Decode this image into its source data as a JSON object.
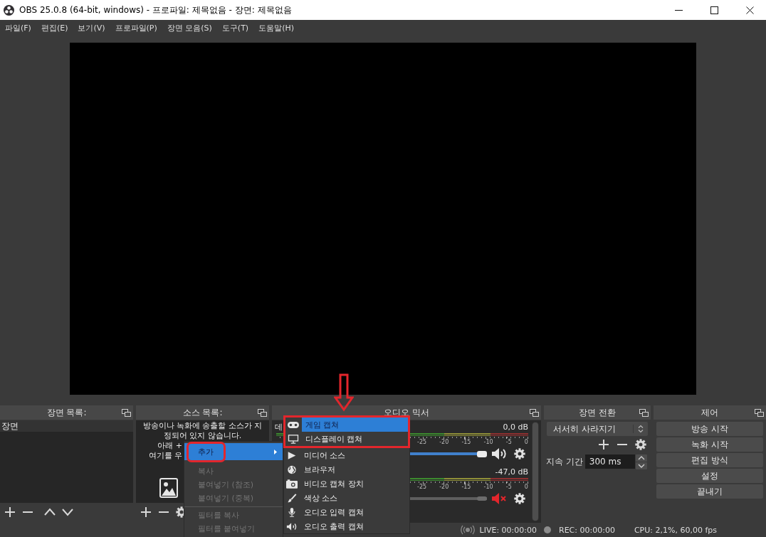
{
  "window": {
    "title": "OBS 25.0.8 (64-bit, windows) - 프로파일: 제목없음 - 장면: 제목없음"
  },
  "menu_bar": [
    "파일(F)",
    "편집(E)",
    "보기(V)",
    "프로파일(P)",
    "장면 모음(S)",
    "도구(T)",
    "도움말(H)"
  ],
  "scene_list": {
    "title": "장면 목록:",
    "items": [
      {
        "label": "장면",
        "selected": true
      }
    ]
  },
  "source_list": {
    "title": "소스 목록:",
    "hint": [
      "방송이나 녹화에 송출할 소스가 지",
      "정되어 있지 않습니다."
    ],
    "hint_cut": [
      "아래 +",
      "여기를 우"
    ]
  },
  "audio_mixer": {
    "title": "오디오 믹서",
    "channels": [
      {
        "name": "데",
        "reading": "0,0 dB",
        "scale": [
          "-25",
          "-20",
          "-15",
          "-10",
          "-5",
          "0"
        ],
        "muted": false,
        "level": 1
      },
      {
        "reading": "-47,0 dB",
        "scale": [
          "-25",
          "-20",
          "-15",
          "-10",
          "-5",
          "0"
        ],
        "muted": true,
        "level": 1
      }
    ]
  },
  "scene_transitions": {
    "title": "장면 전환",
    "transition": "서서히 사라지기",
    "duration_label": "지속 기간",
    "duration": "300 ms"
  },
  "controls": {
    "title": "제어",
    "buttons": [
      "방송 시작",
      "녹화 시작",
      "편집 방식",
      "설정",
      "끝내기"
    ]
  },
  "status_bar": {
    "live": "LIVE: 00:00:00",
    "rec": "REC: 00:00:00",
    "cpu": "CPU: 2,1%, 60,00 fps"
  },
  "context_menu": {
    "items": [
      {
        "kind": "item",
        "label": "추가",
        "selected": true,
        "disabled": false,
        "submenu": true,
        "annotated": true
      },
      {
        "kind": "item",
        "label": "복사",
        "selected": false,
        "disabled": true,
        "submenu": false,
        "annotated": false
      },
      {
        "kind": "item",
        "label": "붙여넣기 (참조)",
        "selected": false,
        "disabled": true,
        "submenu": false,
        "annotated": false
      },
      {
        "kind": "item",
        "label": "붙여넣기 (중복)",
        "selected": false,
        "disabled": true,
        "submenu": false,
        "annotated": false
      },
      {
        "kind": "separator"
      },
      {
        "kind": "item",
        "label": "필터를 복사",
        "selected": false,
        "disabled": true,
        "submenu": false,
        "annotated": false
      },
      {
        "kind": "item",
        "label": "필터를 붙여넣기",
        "selected": false,
        "disabled": true,
        "submenu": false,
        "annotated": false
      }
    ]
  },
  "submenu": {
    "marked_with_arrow": true,
    "items": [
      {
        "label": "게임 캡쳐",
        "selected": true,
        "annotated": true
      },
      {
        "label": "디스플레이 캡쳐",
        "selected": false,
        "annotated": true
      },
      {
        "label": "미디어 소스",
        "selected": false,
        "annotated": false
      },
      {
        "label": "브라우저",
        "selected": false,
        "annotated": false
      },
      {
        "label": "비디오 캡쳐 장치",
        "selected": false,
        "annotated": false
      },
      {
        "label": "색상 소스",
        "selected": false,
        "annotated": false
      },
      {
        "label": "오디오 입력 캡쳐",
        "selected": false,
        "annotated": false
      },
      {
        "label": "오디오 출력 캡쳐",
        "selected": false,
        "annotated": false
      }
    ]
  }
}
